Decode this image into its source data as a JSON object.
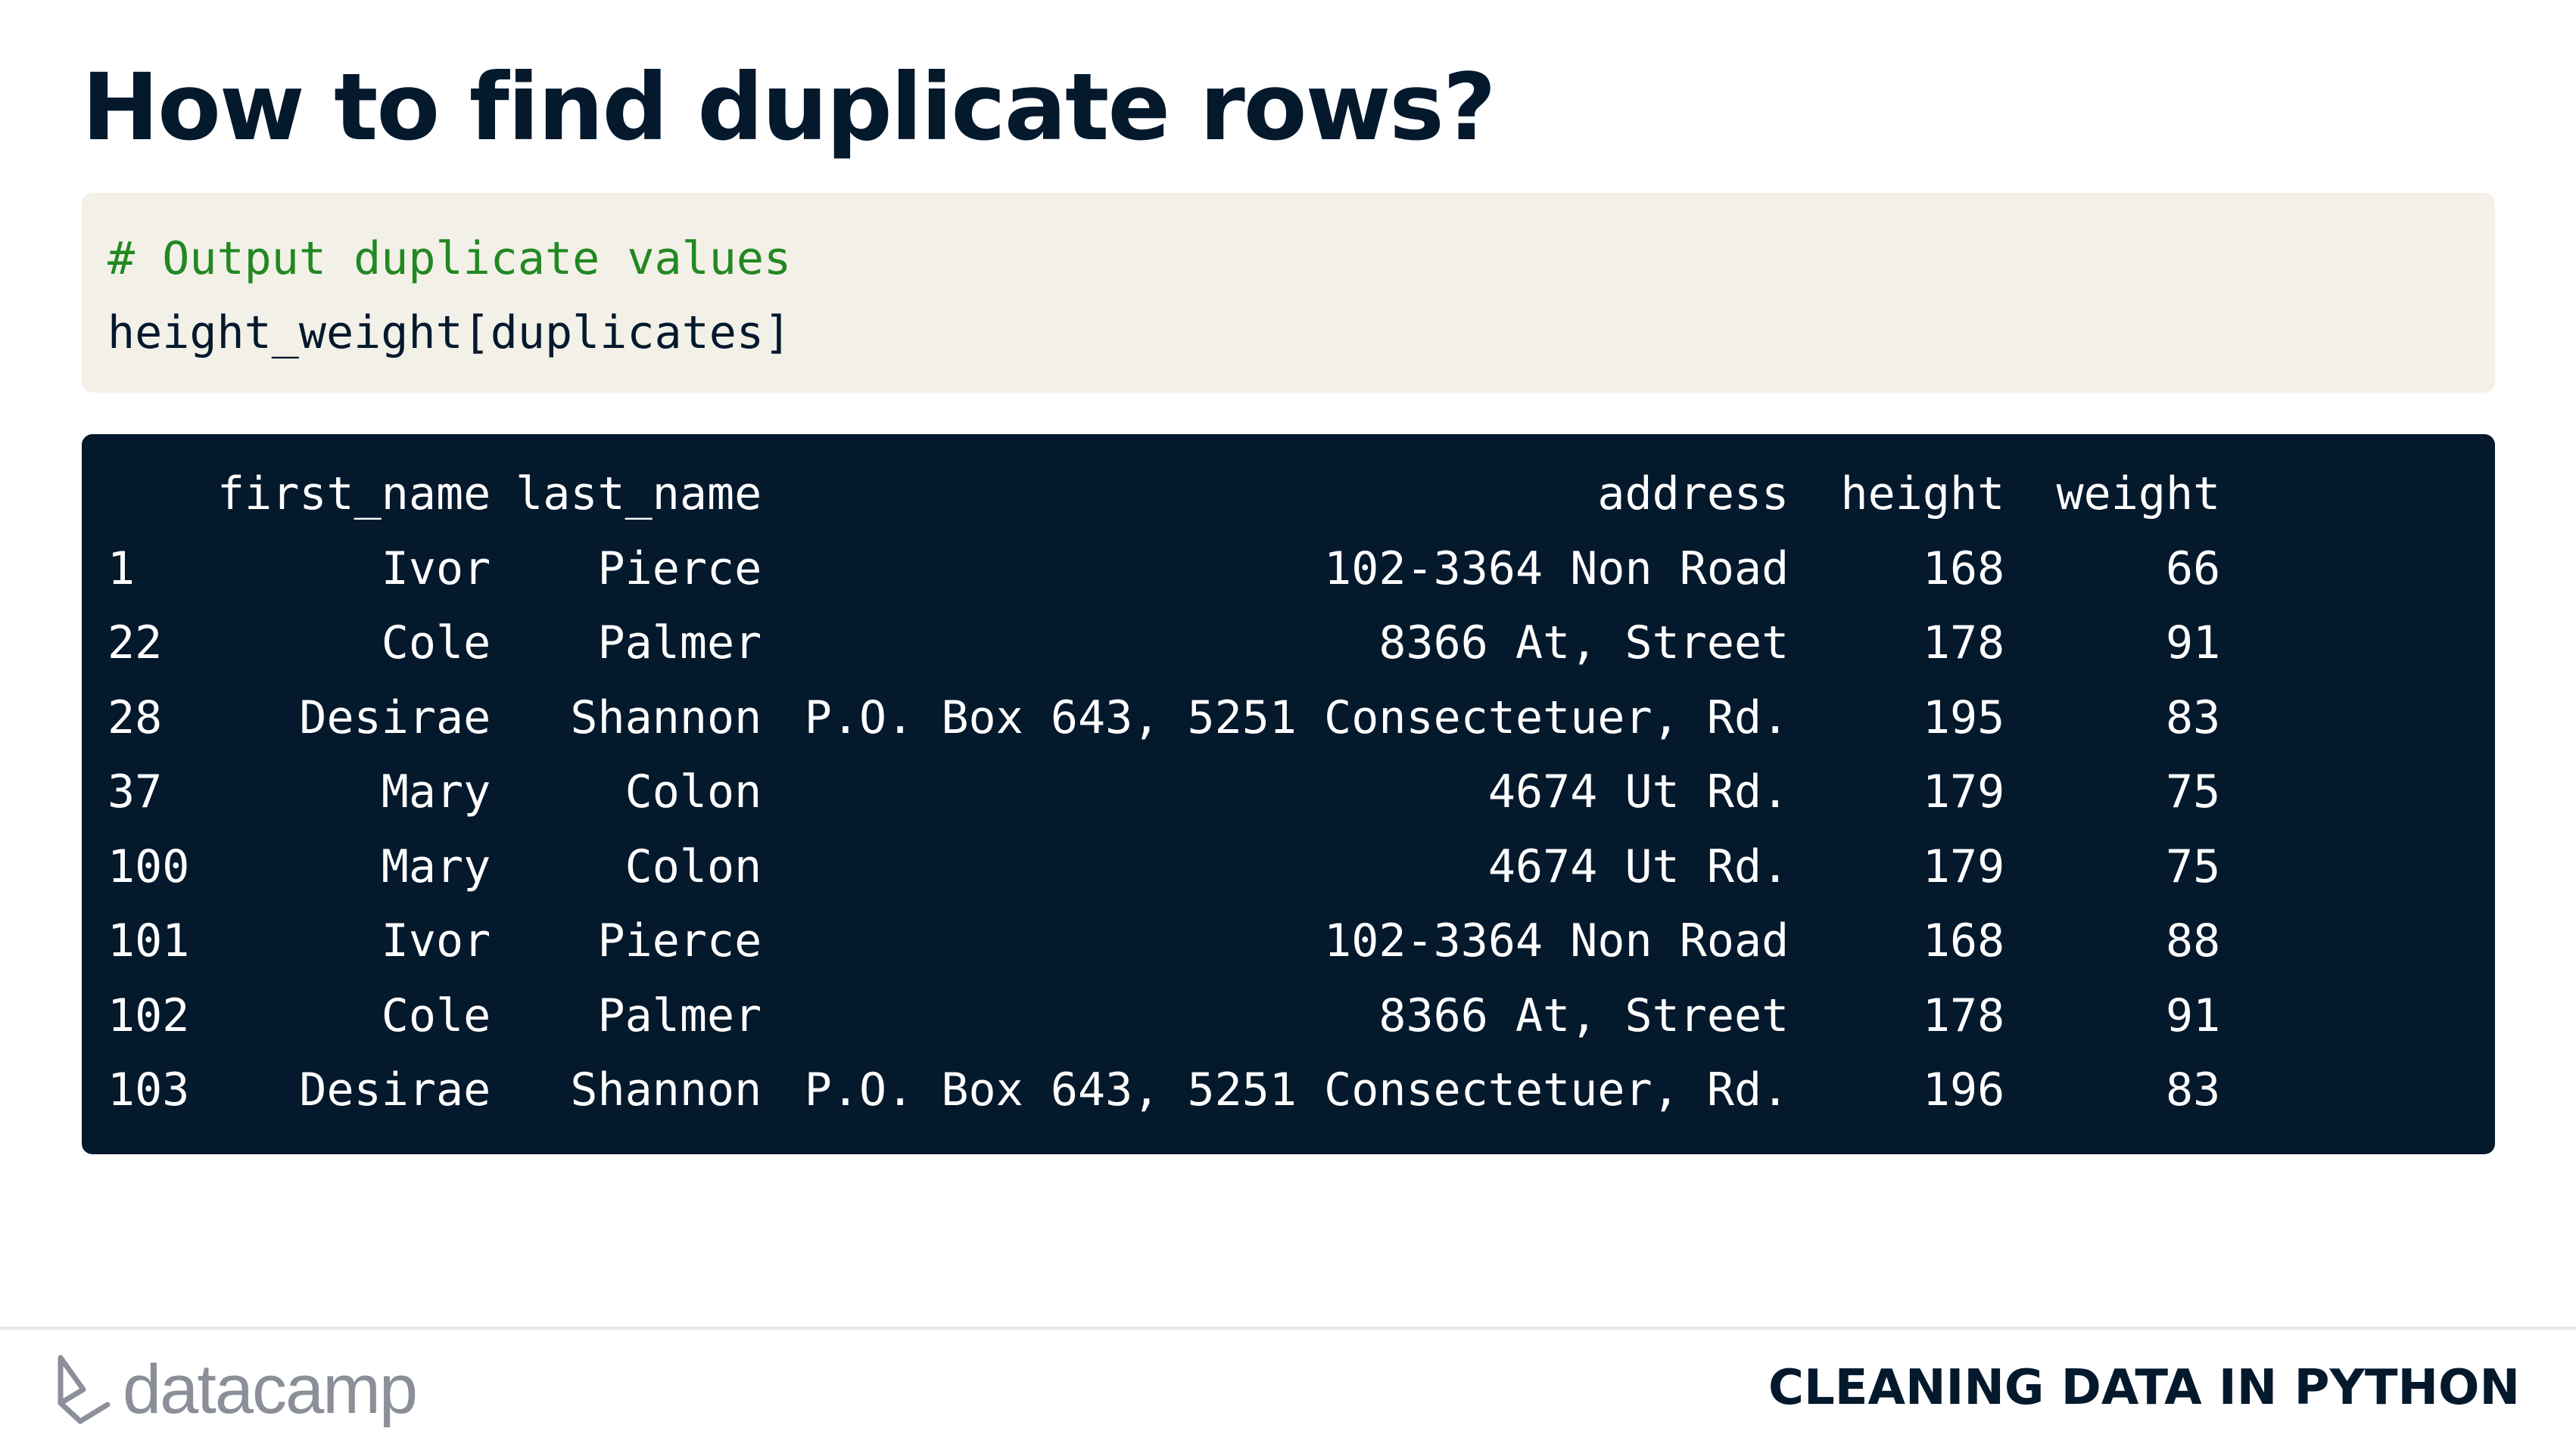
{
  "slide": {
    "title": "How to find duplicate rows?"
  },
  "code": {
    "lines": [
      {
        "kind": "comment",
        "text": "# Output duplicate values"
      },
      {
        "kind": "code",
        "text": "height_weight[duplicates]"
      }
    ]
  },
  "output": {
    "columns": [
      "",
      "first_name",
      "last_name",
      "address",
      "height",
      "weight"
    ],
    "rows": [
      [
        "1",
        "Ivor",
        "Pierce",
        "102-3364 Non Road",
        "168",
        "66"
      ],
      [
        "22",
        "Cole",
        "Palmer",
        "8366 At, Street",
        "178",
        "91"
      ],
      [
        "28",
        "Desirae",
        "Shannon",
        "P.O. Box 643, 5251 Consectetuer, Rd.",
        "195",
        "83"
      ],
      [
        "37",
        "Mary",
        "Colon",
        "4674 Ut Rd.",
        "179",
        "75"
      ],
      [
        "100",
        "Mary",
        "Colon",
        "4674 Ut Rd.",
        "179",
        "75"
      ],
      [
        "101",
        "Ivor",
        "Pierce",
        "102-3364 Non Road",
        "168",
        "88"
      ],
      [
        "102",
        "Cole",
        "Palmer",
        "8366 At, Street",
        "178",
        "91"
      ],
      [
        "103",
        "Desirae",
        "Shannon",
        "P.O. Box 643, 5251 Consectetuer, Rd.",
        "196",
        "83"
      ]
    ]
  },
  "footer": {
    "logo_text": "datacamp",
    "logo_icon": "datacamp-logo-icon",
    "course_name": "CLEANING DATA IN PYTHON"
  },
  "colors": {
    "title": "#05192d",
    "code_background": "#f3f0e8",
    "code_comment": "#228822",
    "output_background": "#05192d",
    "output_text": "#ffffff",
    "logo_gray": "#8a8f98"
  }
}
